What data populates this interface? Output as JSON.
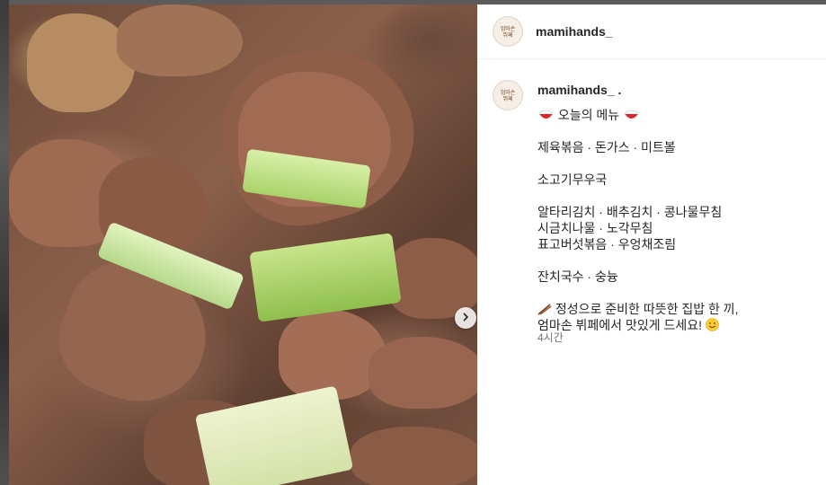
{
  "header": {
    "username": "mamihands_"
  },
  "post": {
    "author": "mamihands_ .",
    "menu_title": "오늘의 메뉴",
    "lines": [
      "제육볶음 · 돈가스 · 미트볼",
      "소고기무우국",
      "알타리김치 · 배추김치 · 콩나물무침",
      "시금치나물 · 노각무침",
      "표고버섯볶음 · 우엉채조림",
      "잔치국수 · 숭늉",
      "정성으로 준비한 따뜻한 집밥 한 끼,",
      "엄마손 뷔페에서 맛있게 드세요!"
    ],
    "time": "4시간"
  },
  "avatar_text": "엄마손\n뷔페",
  "icons": {
    "menu_emoji": "rice-bowl-icon",
    "chopsticks": "chopsticks-icon",
    "smile": "smile-icon",
    "carousel": "chevron-right-icon"
  },
  "colors": {
    "username": "#262626",
    "muted": "#737373",
    "divider": "#efefef"
  }
}
